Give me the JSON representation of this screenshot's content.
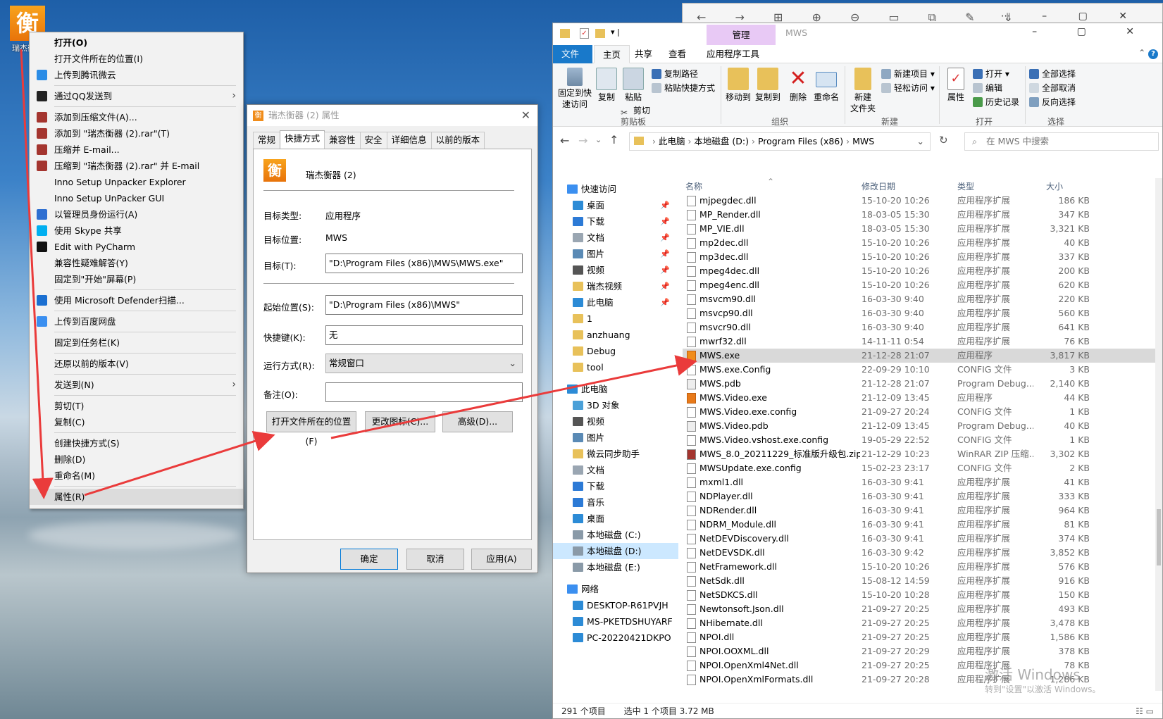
{
  "desktop": {
    "icon_label": "瑞杰衡器"
  },
  "context_menu": {
    "items": [
      {
        "label": "打开(O)",
        "bold": true
      },
      {
        "label": "打开文件所在的位置(I)"
      },
      {
        "label": "上传到腾讯微云",
        "icon": "cloud-icon",
        "color": "#2a8ce6"
      },
      {
        "sep": true
      },
      {
        "label": "通过QQ发送到",
        "icon": "qq-icon",
        "color": "#222",
        "submenu": true
      },
      {
        "sep": true
      },
      {
        "label": "添加到压缩文件(A)...",
        "icon": "winrar-icon",
        "color": "#a4352f"
      },
      {
        "label": "添加到 \"瑞杰衡器 (2).rar\"(T)",
        "icon": "winrar-icon",
        "color": "#a4352f"
      },
      {
        "label": "压缩并 E-mail...",
        "icon": "winrar-icon",
        "color": "#a4352f"
      },
      {
        "label": "压缩到 \"瑞杰衡器 (2).rar\" 并 E-mail",
        "icon": "winrar-icon",
        "color": "#a4352f"
      },
      {
        "label": "Inno Setup Unpacker Explorer"
      },
      {
        "label": "Inno Setup UnPacker GUI"
      },
      {
        "label": "以管理员身份运行(A)",
        "icon": "shield-icon",
        "color": "#2f6fd1"
      },
      {
        "label": "使用 Skype 共享",
        "icon": "skype-icon",
        "color": "#00aff0"
      },
      {
        "label": "Edit with PyCharm",
        "icon": "pycharm-icon",
        "color": "#111"
      },
      {
        "label": "兼容性疑难解答(Y)"
      },
      {
        "label": "固定到\"开始\"屏幕(P)"
      },
      {
        "sep": true
      },
      {
        "label": "使用 Microsoft Defender扫描...",
        "icon": "defender-icon",
        "color": "#1b6fd1"
      },
      {
        "sep": true
      },
      {
        "label": "上传到百度网盘",
        "icon": "baidu-icon",
        "color": "#3b8ff0"
      },
      {
        "sep": true
      },
      {
        "label": "固定到任务栏(K)"
      },
      {
        "sep": true
      },
      {
        "label": "还原以前的版本(V)"
      },
      {
        "sep": true
      },
      {
        "label": "发送到(N)",
        "submenu": true
      },
      {
        "sep": true
      },
      {
        "label": "剪切(T)"
      },
      {
        "label": "复制(C)"
      },
      {
        "sep": true
      },
      {
        "label": "创建快捷方式(S)"
      },
      {
        "label": "删除(D)"
      },
      {
        "label": "重命名(M)"
      },
      {
        "sep": true
      },
      {
        "label": "属性(R)",
        "highlight": true
      }
    ]
  },
  "dialog": {
    "title": "瑞杰衡器 (2) 属性",
    "tabs": [
      "常规",
      "快捷方式",
      "兼容性",
      "安全",
      "详细信息",
      "以前的版本"
    ],
    "active_tab": 1,
    "name": "瑞杰衡器 (2)",
    "target_type_label": "目标类型:",
    "target_type": "应用程序",
    "target_loc_label": "目标位置:",
    "target_loc": "MWS",
    "target_label": "目标(T):",
    "target": "\"D:\\Program Files (x86)\\MWS\\MWS.exe\"",
    "start_label": "起始位置(S):",
    "start": "\"D:\\Program Files (x86)\\MWS\"",
    "hotkey_label": "快捷键(K):",
    "hotkey": "无",
    "run_label": "运行方式(R):",
    "run": "常规窗口",
    "comment_label": "备注(O):",
    "comment": "",
    "btn_open_location": "打开文件所在的位置(F)",
    "btn_change_icon": "更改图标(C)...",
    "btn_advanced": "高级(D)...",
    "btn_ok": "确定",
    "btn_cancel": "取消",
    "btn_apply": "应用(A)"
  },
  "explorer": {
    "title": "MWS",
    "context_tab": "管理",
    "ribbon_tabs": [
      "文件",
      "主页",
      "共享",
      "查看",
      "应用程序工具"
    ],
    "ribbon": {
      "pin": "固定到快\n速访问",
      "copy": "复制",
      "paste": "粘贴",
      "copy_path": "复制路径",
      "paste_shortcut": "粘贴快捷方式",
      "cut": "剪切",
      "move_to": "移动到",
      "copy_to": "复制到",
      "delete": "删除",
      "rename": "重命名",
      "new_folder": "新建\n文件夹",
      "new_item": "新建项目 ▾",
      "easy_access": "轻松访问 ▾",
      "properties": "属性",
      "open": "打开 ▾",
      "edit": "编辑",
      "history": "历史记录",
      "select_all": "全部选择",
      "select_none": "全部取消",
      "invert": "反向选择",
      "group_clipboard": "剪贴板",
      "group_organize": "组织",
      "group_new": "新建",
      "group_open": "打开",
      "group_select": "选择"
    },
    "address": [
      "此电脑",
      "本地磁盘 (D:)",
      "Program Files (x86)",
      "MWS"
    ],
    "search_placeholder": "在 MWS 中搜索",
    "nav": [
      {
        "label": "快速访问",
        "color": "#3b8ff0",
        "level": 0
      },
      {
        "label": "桌面",
        "color": "#2c8bd6",
        "pin": true
      },
      {
        "label": "下载",
        "color": "#2c7ad6",
        "pin": true
      },
      {
        "label": "文档",
        "color": "#9aa6b2",
        "pin": true
      },
      {
        "label": "图片",
        "color": "#5a8ab5",
        "pin": true
      },
      {
        "label": "视频",
        "color": "#555",
        "pin": true
      },
      {
        "label": "瑞杰视频",
        "color": "#e8c15a",
        "pin": true
      },
      {
        "label": "此电脑",
        "color": "#2c8bd6",
        "pin": true
      },
      {
        "label": "1",
        "color": "#e8c15a"
      },
      {
        "label": "anzhuang",
        "color": "#e8c15a"
      },
      {
        "label": "Debug",
        "color": "#e8c15a"
      },
      {
        "label": "tool",
        "color": "#e8c15a"
      },
      {
        "gap": true
      },
      {
        "label": "此电脑",
        "color": "#2c8bd6",
        "level": 0
      },
      {
        "label": "3D 对象",
        "color": "#4aa0d8"
      },
      {
        "label": "视频",
        "color": "#555"
      },
      {
        "label": "图片",
        "color": "#5a8ab5"
      },
      {
        "label": "微云同步助手",
        "color": "#e8c15a"
      },
      {
        "label": "文档",
        "color": "#9aa6b2"
      },
      {
        "label": "下载",
        "color": "#2c7ad6"
      },
      {
        "label": "音乐",
        "color": "#2c7ad6"
      },
      {
        "label": "桌面",
        "color": "#2c8bd6"
      },
      {
        "label": "本地磁盘 (C:)",
        "color": "#8a9aa8"
      },
      {
        "label": "本地磁盘 (D:)",
        "color": "#8a9aa8",
        "selected": true
      },
      {
        "label": "本地磁盘 (E:)",
        "color": "#8a9aa8"
      },
      {
        "gap": true
      },
      {
        "label": "网络",
        "color": "#3b8ff0",
        "level": 0
      },
      {
        "label": "DESKTOP-R61PVJH",
        "color": "#2c8bd6"
      },
      {
        "label": "MS-PKETDSHUYARF",
        "color": "#2c8bd6"
      },
      {
        "label": "PC-20220421DKPO",
        "color": "#2c8bd6"
      }
    ],
    "columns": [
      "名称",
      "修改日期",
      "类型",
      "大小"
    ],
    "files": [
      [
        "mjpegdec.dll",
        "15-10-20 10:26",
        "应用程序扩展",
        "186 KB"
      ],
      [
        "MP_Render.dll",
        "18-03-05 15:30",
        "应用程序扩展",
        "347 KB"
      ],
      [
        "MP_VIE.dll",
        "18-03-05 15:30",
        "应用程序扩展",
        "3,321 KB"
      ],
      [
        "mp2dec.dll",
        "15-10-20 10:26",
        "应用程序扩展",
        "40 KB"
      ],
      [
        "mp3dec.dll",
        "15-10-20 10:26",
        "应用程序扩展",
        "337 KB"
      ],
      [
        "mpeg4dec.dll",
        "15-10-20 10:26",
        "应用程序扩展",
        "200 KB"
      ],
      [
        "mpeg4enc.dll",
        "15-10-20 10:26",
        "应用程序扩展",
        "620 KB"
      ],
      [
        "msvcm90.dll",
        "16-03-30 9:40",
        "应用程序扩展",
        "220 KB"
      ],
      [
        "msvcp90.dll",
        "16-03-30 9:40",
        "应用程序扩展",
        "560 KB"
      ],
      [
        "msvcr90.dll",
        "16-03-30 9:40",
        "应用程序扩展",
        "641 KB"
      ],
      [
        "mwrf32.dll",
        "14-11-11 0:54",
        "应用程序扩展",
        "76 KB"
      ],
      [
        "MWS.exe",
        "21-12-28 21:07",
        "应用程序",
        "3,817 KB"
      ],
      [
        "MWS.exe.Config",
        "22-09-29 10:10",
        "CONFIG 文件",
        "3 KB"
      ],
      [
        "MWS.pdb",
        "21-12-28 21:07",
        "Program Debug...",
        "2,140 KB"
      ],
      [
        "MWS.Video.exe",
        "21-12-09 13:45",
        "应用程序",
        "44 KB"
      ],
      [
        "MWS.Video.exe.config",
        "21-09-27 20:24",
        "CONFIG 文件",
        "1 KB"
      ],
      [
        "MWS.Video.pdb",
        "21-12-09 13:45",
        "Program Debug...",
        "40 KB"
      ],
      [
        "MWS.Video.vshost.exe.config",
        "19-05-29 22:52",
        "CONFIG 文件",
        "1 KB"
      ],
      [
        "MWS_8.0_20211229_标准版升级包.zip",
        "21-12-29 10:23",
        "WinRAR ZIP 压缩...",
        "3,302 KB"
      ],
      [
        "MWSUpdate.exe.config",
        "15-02-23 23:17",
        "CONFIG 文件",
        "2 KB"
      ],
      [
        "mxml1.dll",
        "16-03-30 9:41",
        "应用程序扩展",
        "41 KB"
      ],
      [
        "NDPlayer.dll",
        "16-03-30 9:41",
        "应用程序扩展",
        "333 KB"
      ],
      [
        "NDRender.dll",
        "16-03-30 9:41",
        "应用程序扩展",
        "964 KB"
      ],
      [
        "NDRM_Module.dll",
        "16-03-30 9:41",
        "应用程序扩展",
        "81 KB"
      ],
      [
        "NetDEVDiscovery.dll",
        "16-03-30 9:41",
        "应用程序扩展",
        "374 KB"
      ],
      [
        "NetDEVSDK.dll",
        "16-03-30 9:42",
        "应用程序扩展",
        "3,852 KB"
      ],
      [
        "NetFramework.dll",
        "15-10-20 10:26",
        "应用程序扩展",
        "576 KB"
      ],
      [
        "NetSdk.dll",
        "15-08-12 14:59",
        "应用程序扩展",
        "916 KB"
      ],
      [
        "NetSDKCS.dll",
        "15-10-20 10:28",
        "应用程序扩展",
        "150 KB"
      ],
      [
        "Newtonsoft.Json.dll",
        "21-09-27 20:25",
        "应用程序扩展",
        "493 KB"
      ],
      [
        "NHibernate.dll",
        "21-09-27 20:25",
        "应用程序扩展",
        "3,478 KB"
      ],
      [
        "NPOI.dll",
        "21-09-27 20:25",
        "应用程序扩展",
        "1,586 KB"
      ],
      [
        "NPOI.OOXML.dll",
        "21-09-27 20:29",
        "应用程序扩展",
        "378 KB"
      ],
      [
        "NPOI.OpenXml4Net.dll",
        "21-09-27 20:25",
        "应用程序扩展",
        "78 KB"
      ],
      [
        "NPOI.OpenXmlFormats.dll",
        "21-09-27 20:28",
        "应用程序扩展",
        "1,286 KB"
      ]
    ],
    "selected_file": 11,
    "status_count": "291 个项目",
    "status_selected": "选中 1 个项目  3.72 MB"
  },
  "watermark": {
    "line1": "激活 Windows",
    "line2": "转到\"设置\"以激活 Windows。"
  },
  "colors": {
    "accent": "#1979ca",
    "arrow": "#ea3b3b",
    "selection": "#d9d9d9",
    "nav_selection": "#cce8ff"
  }
}
